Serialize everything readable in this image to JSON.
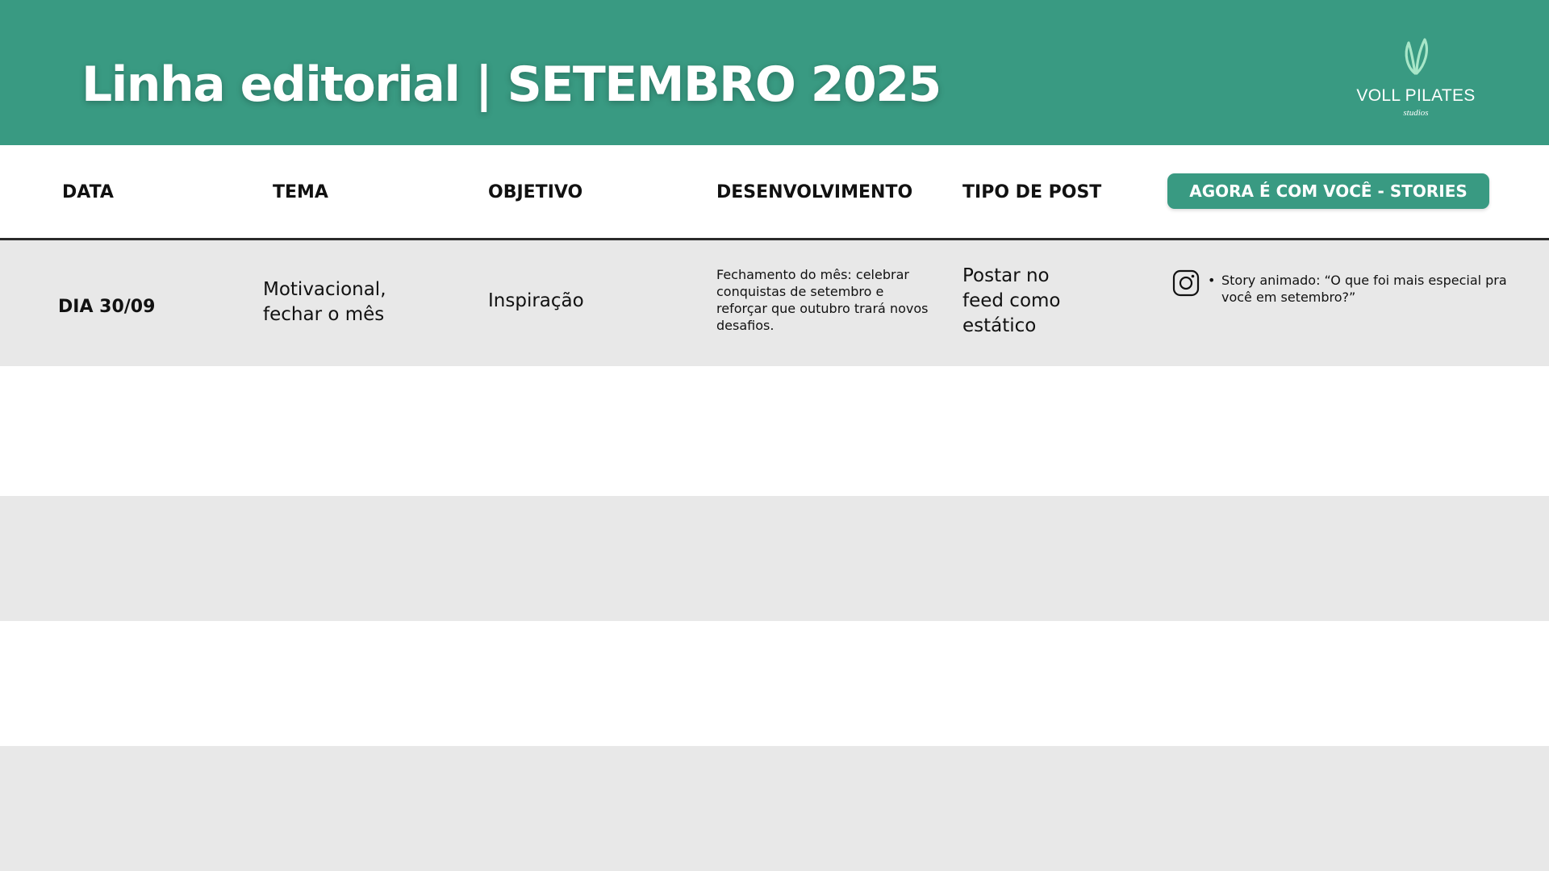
{
  "header": {
    "title": "Linha editorial | SETEMBRO 2025",
    "brand_color": "#399a82",
    "logo": {
      "name": "VOLL PILATES",
      "subtitle": "studios",
      "icon": "voll-leaf-logo"
    }
  },
  "table": {
    "columns": [
      "DATA",
      "TEMA",
      "OBJETIVO",
      "DESENVOLVIMENTO",
      "TIPO DE POST",
      "AGORA É COM VOCÊ - STORIES"
    ],
    "band_colors": {
      "gray": "#e8e8e8",
      "white": "#ffffff"
    },
    "rows": [
      {
        "date": "DIA 30/09",
        "tema": "Motivacional, fechar o mês",
        "objetivo": "Inspiração",
        "desenvolvimento": "Fechamento do mês: celebrar conquistas de setembro e reforçar que outubro trará novos desafios.",
        "tipo_de_post": "Postar no feed como estático",
        "stories": {
          "icon": "instagram-icon",
          "bullet": "•",
          "items": [
            "Story animado: “O que foi mais especial pra você em setembro?”"
          ]
        }
      }
    ]
  }
}
